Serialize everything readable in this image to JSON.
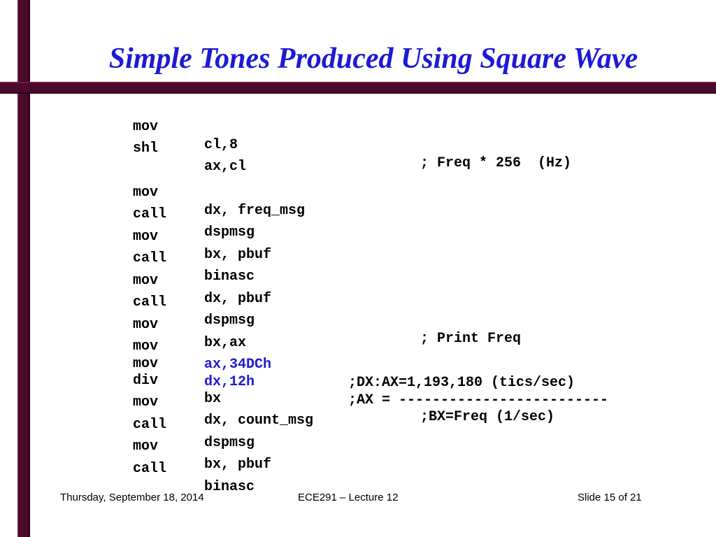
{
  "slide": {
    "title": "Simple Tones Produced Using Square Wave",
    "code_lines": [
      {
        "op": "mov",
        "arg": "cl,8",
        "comment": "; Freq * 256  (Hz)"
      },
      {
        "op": "shl",
        "arg": "ax,cl",
        "comment": ""
      },
      {
        "op": "mov",
        "arg": "dx, freq_msg",
        "comment": ""
      },
      {
        "op": "call",
        "arg": "dspmsg",
        "comment": ""
      },
      {
        "op": "mov",
        "arg": "bx, pbuf",
        "comment": ""
      },
      {
        "op": "call",
        "arg": "binasc",
        "comment": ""
      },
      {
        "op": "mov",
        "arg": "dx, pbuf",
        "comment": ""
      },
      {
        "op": "call",
        "arg": "dspmsg",
        "comment": "; Print Freq"
      },
      {
        "op": "mov",
        "arg": "bx,ax",
        "comment": ""
      },
      {
        "op": "mov",
        "arg": "ax,34DCh",
        "comment": ";DX:AX=1,193,180 (tics/sec)"
      },
      {
        "op": "mov",
        "arg": "dx,12h",
        "comment": ";AX = -------------------------"
      },
      {
        "op": "div",
        "arg": "bx",
        "comment": ";BX=Freq (1/sec)"
      },
      {
        "op": "mov",
        "arg": "dx, count_msg",
        "comment": ""
      },
      {
        "op": "call",
        "arg": "dspmsg",
        "comment": ""
      },
      {
        "op": "mov",
        "arg": "bx, pbuf",
        "comment": ""
      },
      {
        "op": "call",
        "arg": "binasc",
        "comment": ""
      }
    ]
  },
  "footer": {
    "date": "Thursday, September 18, 2014",
    "course": "ECE291 – Lecture 12",
    "slide_number": "Slide 15 of 21"
  },
  "colors": {
    "title": "#1c1ad6",
    "highlight": "#1c1ad6",
    "frame": "#4a0a2a"
  }
}
